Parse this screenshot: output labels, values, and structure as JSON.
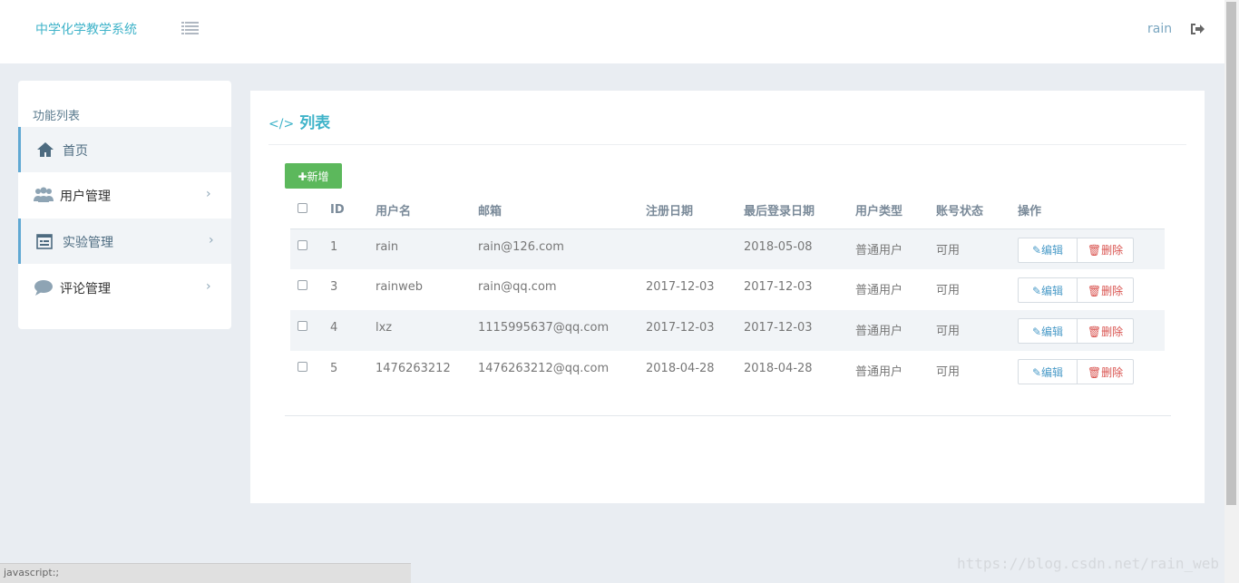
{
  "header": {
    "brand": "中学化学教学系统",
    "user": "rain"
  },
  "sidebar": {
    "title": "功能列表",
    "items": [
      {
        "label": "首页",
        "icon": "home-icon"
      },
      {
        "label": "用户管理",
        "icon": "users-icon"
      },
      {
        "label": "实验管理",
        "icon": "calendar-icon"
      },
      {
        "label": "评论管理",
        "icon": "comment-icon"
      }
    ]
  },
  "panel": {
    "title": "列表",
    "add_label": "新增"
  },
  "table": {
    "headers": [
      "ID",
      "用户名",
      "邮箱",
      "注册日期",
      "最后登录日期",
      "用户类型",
      "账号状态",
      "操作"
    ],
    "edit_label": "编辑",
    "delete_label": "删除",
    "rows": [
      {
        "id": "1",
        "username": "rain",
        "email": "rain@126.com",
        "reg_date": "",
        "last_login": "2018-05-08",
        "type": "普通用户",
        "status": "可用"
      },
      {
        "id": "3",
        "username": "rainweb",
        "email": "rain@qq.com",
        "reg_date": "2017-12-03",
        "last_login": "2017-12-03",
        "type": "普通用户",
        "status": "可用"
      },
      {
        "id": "4",
        "username": "lxz",
        "email": "1115995637@qq.com",
        "reg_date": "2017-12-03",
        "last_login": "2017-12-03",
        "type": "普通用户",
        "status": "可用"
      },
      {
        "id": "5",
        "username": "1476263212",
        "email": "1476263212@qq.com",
        "reg_date": "2018-04-28",
        "last_login": "2018-04-28",
        "type": "普通用户",
        "status": "可用"
      }
    ]
  },
  "status_bar": "javascript:;",
  "watermark": "https://blog.csdn.net/rain_web"
}
